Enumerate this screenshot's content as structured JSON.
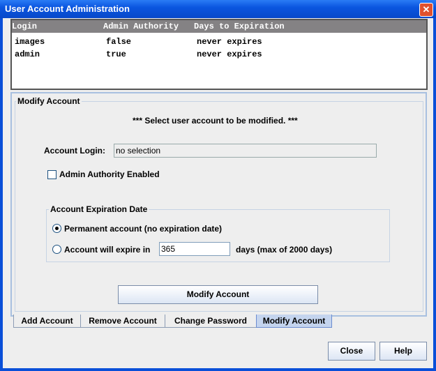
{
  "window": {
    "title": "User Account Administration"
  },
  "table": {
    "headers": [
      "Login",
      "Admin Authority",
      "Days to Expiration"
    ],
    "rows": [
      [
        "images",
        "false",
        "never expires"
      ],
      [
        "admin",
        "true",
        "never expires"
      ]
    ]
  },
  "panel": {
    "title": "Modify Account",
    "instruction": "*** Select user account to be modified. ***",
    "login_label": "Account Login:",
    "login_value": "no selection",
    "admin_checkbox": "Admin Authority Enabled",
    "admin_checked": false,
    "expiration_group": "Account Expiration Date",
    "radio_permanent": "Permanent account (no expiration date)",
    "radio_expire": "Account will expire in",
    "days_value": "365",
    "days_suffix": "days (max of 2000 days)",
    "selected": "permanent",
    "modify_button": "Modify Account"
  },
  "tabs": [
    "Add Account",
    "Remove Account",
    "Change Password",
    "Modify Account"
  ],
  "active_tab": "Modify Account",
  "buttons": {
    "close": "Close",
    "help": "Help"
  }
}
